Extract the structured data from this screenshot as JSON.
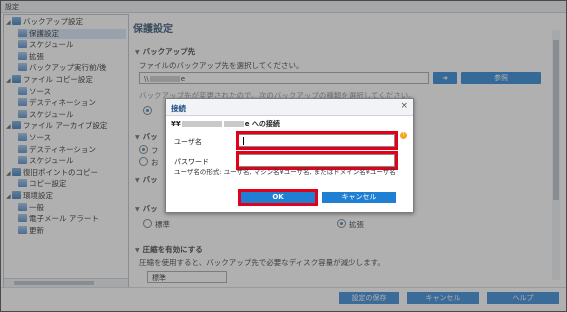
{
  "window": {
    "title": "設定"
  },
  "tree": [
    {
      "label": "バックアップ設定",
      "level": 0,
      "twisty": "◢",
      "icon": "group"
    },
    {
      "label": "保護設定",
      "level": 1,
      "selected": true,
      "icon": "leaf"
    },
    {
      "label": "スケジュール",
      "level": 1,
      "icon": "leaf"
    },
    {
      "label": "拡張",
      "level": 1,
      "icon": "leaf"
    },
    {
      "label": "バックアップ実行前/後",
      "level": 1,
      "icon": "leaf"
    },
    {
      "label": "ファイル コピー設定",
      "level": 0,
      "twisty": "◢",
      "icon": "group"
    },
    {
      "label": "ソース",
      "level": 1,
      "icon": "leaf"
    },
    {
      "label": "デスティネーション",
      "level": 1,
      "icon": "leaf"
    },
    {
      "label": "スケジュール",
      "level": 1,
      "icon": "leaf"
    },
    {
      "label": "ファイル アーカイブ設定",
      "level": 0,
      "twisty": "◢",
      "icon": "group"
    },
    {
      "label": "ソース",
      "level": 1,
      "icon": "leaf"
    },
    {
      "label": "デスティネーション",
      "level": 1,
      "icon": "leaf"
    },
    {
      "label": "スケジュール",
      "level": 1,
      "icon": "leaf"
    },
    {
      "label": "復旧ポイントのコピー",
      "level": 0,
      "twisty": "◢",
      "icon": "group"
    },
    {
      "label": "コピー設定",
      "level": 1,
      "icon": "leaf"
    },
    {
      "label": "環境設定",
      "level": 0,
      "twisty": "◢",
      "icon": "group"
    },
    {
      "label": "一般",
      "level": 1,
      "icon": "leaf"
    },
    {
      "label": "電子メール アラート",
      "level": 1,
      "icon": "leaf"
    },
    {
      "label": "更新",
      "level": 1,
      "icon": "leaf"
    }
  ],
  "main": {
    "header": "保護設定",
    "sec_dest": "バックアップ先",
    "dest_desc": "ファイルのバックアップ先を選択してください。",
    "dest_path": "\\\\",
    "dest_path_tail": "e",
    "browse_label": "参照",
    "change_note": "バックアップ先が変更されたので、次のバックアップの種類を選択してください。",
    "sec_ba": "バッ",
    "sec_ba2": "バッ",
    "sec_ba3": "バッ",
    "opt_radio_a": "フ",
    "opt_radio_b": "お",
    "radio_standard": "標準",
    "radio_extended": "拡張",
    "sec_compress": "圧縮を有効にする",
    "compress_desc": "圧縮を使用すると、バックアップ先で必要なディスク容量が減少します。",
    "compress_value": "標準"
  },
  "bottom": {
    "save": "設定の保存",
    "cancel": "キャンセル",
    "help": "ヘルプ"
  },
  "dialog": {
    "title": "接続",
    "conn_prefix": "¥¥",
    "conn_mid": "e への接続",
    "username_label": "ユーザ名",
    "password_label": "パスワード",
    "username_value": "",
    "hint": "ユーザ名の形式: ユーザ名, マシン名¥ユーザ名, またはドメイン名¥ユーザ名",
    "ok": "OK",
    "cancel": "キャンセル",
    "close": "×"
  },
  "colors": {
    "accent": "#1e7fd3",
    "highlight": "#e2001a"
  }
}
